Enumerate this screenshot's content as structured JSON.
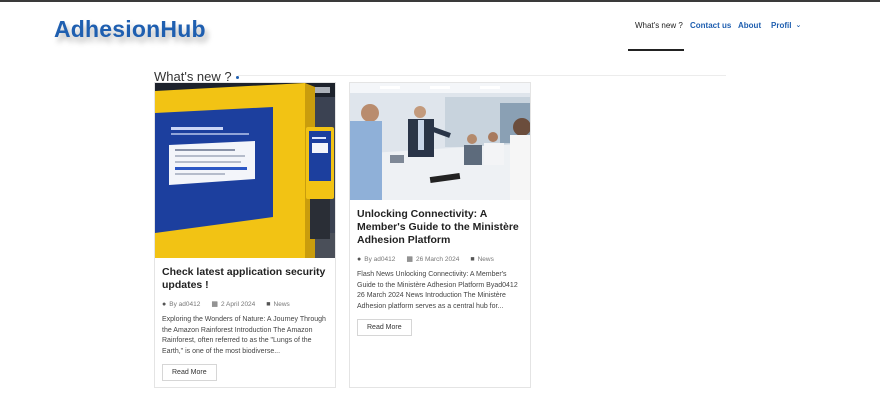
{
  "brand": {
    "logo": "AdhesionHub"
  },
  "nav": {
    "whats_new": "What's new ?",
    "contact": "Contact us",
    "about": "About",
    "profil": "Profil"
  },
  "section": {
    "title": "What's new ?"
  },
  "cards": [
    {
      "title": "Check latest application security updates !",
      "author": "By ad0412",
      "date": "2 April 2024",
      "category": "News",
      "excerpt": "Exploring the Wonders of Nature: A Journey Through the Amazon Rainforest Introduction The Amazon Rainforest, often referred to as the \"Lungs of the Earth,\" is one of the most biodiverse...",
      "read_more": "Read More"
    },
    {
      "title": "Unlocking Connectivity: A Member's Guide to the Ministère Adhesion Platform",
      "author": "By ad0412",
      "date": "26 March 2024",
      "category": "News",
      "excerpt": "Flash News Unlocking Connectivity: A Member's Guide to the Ministère Adhesion Platform Byad0412 26 March 2024 News Introduction The Ministère Adhesion platform serves as a central hub for...",
      "read_more": "Read More"
    }
  ],
  "colors": {
    "brand": "#1f5fb0",
    "kiosk_yellow": "#f2c314"
  }
}
